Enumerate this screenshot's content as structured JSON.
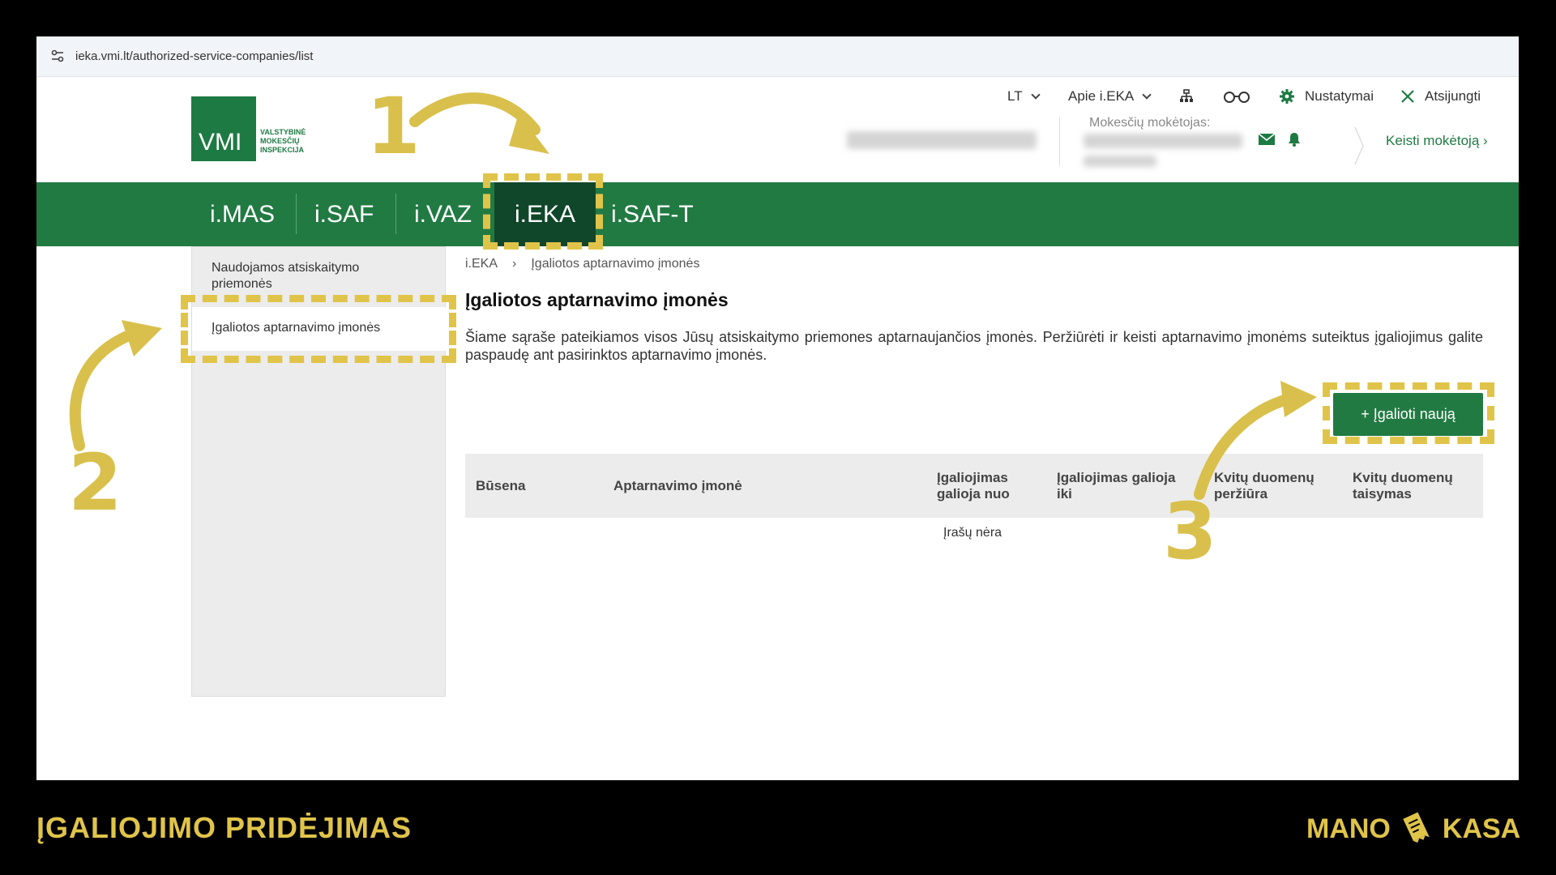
{
  "browser": {
    "url": "ieka.vmi.lt/authorized-service-companies/list"
  },
  "header": {
    "logo_abbr": "VMI",
    "logo_lines": [
      "VALSTYBINĖ",
      "MOKESČIŲ",
      "INSPEKCIJA"
    ],
    "language": "LT",
    "about": "Apie i.EKA",
    "settings": "Nustatymai",
    "logout": "Atsijungti",
    "taxpayer_label": "Mokesčių mokėtojas:",
    "switch_taxpayer": "Keisti mokėtoją"
  },
  "nav": {
    "tabs": [
      {
        "label": "i.MAS"
      },
      {
        "label": "i.SAF"
      },
      {
        "label": "i.VAZ"
      },
      {
        "label": "i.EKA"
      },
      {
        "label": "i.SAF-T"
      }
    ],
    "active": "i.EKA"
  },
  "sidebar": {
    "items": [
      {
        "label": "Naudojamos atsiskaitymo priemonės"
      },
      {
        "label": "Įgaliotos aptarnavimo įmonės"
      }
    ]
  },
  "breadcrumb": {
    "root": "i.EKA",
    "separator": "›",
    "current": "Įgaliotos aptarnavimo įmonės"
  },
  "main": {
    "title": "Įgaliotos aptarnavimo įmonės",
    "description": "Šiame sąraše pateikiamos visos Jūsų atsiskaitymo priemones aptarnaujančios įmonės. Peržiūrėti ir keisti aptarnavimo įmonėms suteiktus įgaliojimus galite paspaudę ant pasirinktos aptarnavimo įmonės.",
    "add_button": "+ Įgalioti naują",
    "table": {
      "headers": [
        "Būsena",
        "Aptarnavimo įmonė",
        "Įgaliojimas galioja nuo",
        "Įgaliojimas galioja iki",
        "Kvitų duomenų peržiūra",
        "Kvitų duomenų taisymas"
      ],
      "empty": "Įrašų nėra"
    }
  },
  "annotations": {
    "steps": [
      "1",
      "2",
      "3"
    ],
    "color": "#e0c44a"
  },
  "footer": {
    "caption": "ĮGALIOJIMO PRIDĖJIMAS",
    "brand_left": "MANO",
    "brand_right": "KASA"
  }
}
